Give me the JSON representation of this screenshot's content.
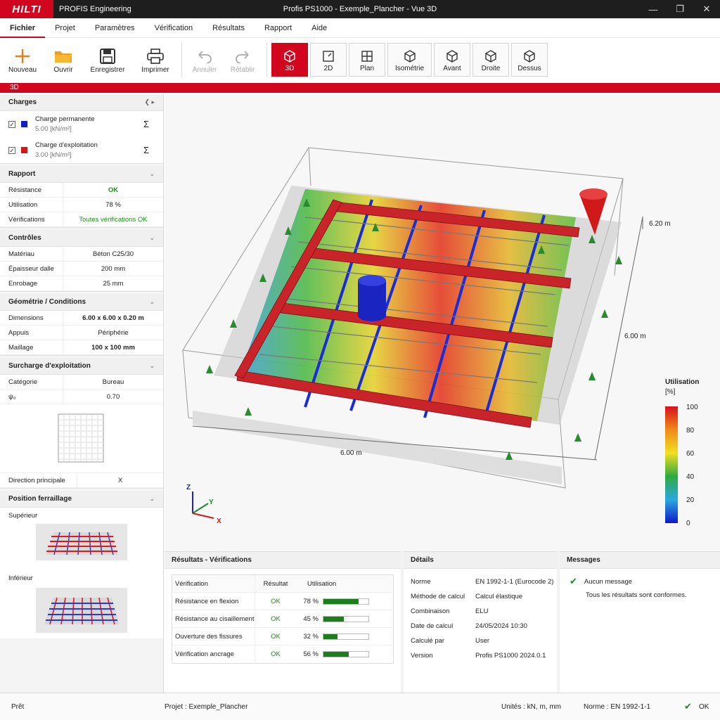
{
  "titlebar": {
    "logo": "HILTI",
    "app_name": "PROFIS Engineering",
    "window_title": "Profis PS1000 - Exemple_Plancher - Vue 3D",
    "controls": [
      "minimize-icon",
      "restore-icon",
      "close-icon"
    ]
  },
  "menu": [
    "Fichier",
    "Projet",
    "Paramètres",
    "Vérification",
    "Résultats",
    "Rapport",
    "Aide"
  ],
  "toolbar": {
    "file_buttons": [
      {
        "label": "Nouveau",
        "icon": "plus-icon"
      },
      {
        "label": "Ouvrir",
        "icon": "folder-icon"
      },
      {
        "label": "Enregistrer",
        "icon": "floppy-disk-icon"
      },
      {
        "label": "Imprimer",
        "icon": "printer-icon"
      }
    ],
    "undo_label": "Annuler",
    "redo_label": "Rétablir",
    "view_buttons": [
      "3D",
      "2D",
      "Plan",
      "Isométrie",
      "Avant",
      "Droite",
      "Dessus"
    ],
    "active_view": "3D"
  },
  "view_label": "3D",
  "colors": {
    "accent": "#d2051e",
    "ok": "#1c8a1c",
    "permanent": "#1020c0",
    "exploitation": "#d01818"
  },
  "left": {
    "charges": {
      "title": "Charges",
      "items": [
        {
          "name": "Charge permanente",
          "value": "5.00",
          "unit": "[kN/m²]"
        },
        {
          "name": "Charge d'exploitation",
          "value": "3.00",
          "unit": "[kN/m²]"
        }
      ]
    },
    "rapport": {
      "title": "Rapport",
      "rows": [
        {
          "k": "Résistance",
          "v": "OK"
        },
        {
          "k": "Utilisation",
          "v": "78 %"
        },
        {
          "k": "Vérifications",
          "v": "Toutes vérifications OK"
        }
      ]
    },
    "controles": {
      "title": "Contrôles",
      "rows": [
        {
          "k": "Matériau",
          "v": "Béton C25/30"
        },
        {
          "k": "Épaisseur dalle",
          "v": "200 mm"
        },
        {
          "k": "Enrobage",
          "v": "25 mm"
        }
      ]
    },
    "geometrie": {
      "title": "Géométrie / Conditions",
      "rows": [
        {
          "k": "Dimensions",
          "v": "6.00 x 6.00 x 0.20 m"
        },
        {
          "k": "Appuis",
          "v": "Périphérie"
        },
        {
          "k": "Maillage",
          "v": "100 x 100 mm"
        }
      ]
    },
    "surcharge": {
      "title": "Surcharge d'exploitation",
      "rows": [
        {
          "k": "Catégorie",
          "v": "Bureau"
        },
        {
          "k": "ψ₀",
          "v": "0.70"
        }
      ],
      "direction_k": "Direction principale",
      "direction_v": "X"
    },
    "ferraillage": {
      "title": "Position ferraillage",
      "superieur": "Supérieur",
      "inferieur": "Inférieur"
    }
  },
  "viewport": {
    "dim_x": "6.00 m",
    "dim_y": "6.00 m",
    "dim_z": "6.20 m",
    "legend_title": "Utilisation",
    "legend_unit": "[%]",
    "legend_ticks": [
      "100",
      "80",
      "60",
      "40",
      "20",
      "0"
    ],
    "axes": {
      "x": "X",
      "y": "Y",
      "z": "Z"
    }
  },
  "results": {
    "title": "Résultats - Vérifications",
    "headers": [
      "Vérification",
      "Résultat",
      "Utilisation"
    ],
    "rows": [
      {
        "name": "Résistance en flexion",
        "status": "OK",
        "util": "78 %",
        "fraction": 0.78
      },
      {
        "name": "Résistance au cisaillement",
        "status": "OK",
        "util": "45 %",
        "fraction": 0.45
      },
      {
        "name": "Ouverture des fissures",
        "status": "OK",
        "util": "32 %",
        "fraction": 0.32
      },
      {
        "name": "Vérification ancrage",
        "status": "OK",
        "util": "56 %",
        "fraction": 0.56
      }
    ]
  },
  "details": {
    "title": "Détails",
    "rows": [
      {
        "k": "Norme",
        "v": "EN 1992-1-1 (Eurocode 2)"
      },
      {
        "k": "Méthode de calcul",
        "v": "Calcul élastique"
      },
      {
        "k": "Combinaison",
        "v": "ELU"
      },
      {
        "k": "Date de calcul",
        "v": "24/05/2024 10:30"
      },
      {
        "k": "Calculé par",
        "v": "User"
      },
      {
        "k": "Version",
        "v": "Profis PS1000 2024.0.1"
      }
    ]
  },
  "messages": {
    "title": "Messages",
    "line1": "Aucun message",
    "line2": "Tous les résultats sont conformes."
  },
  "status": {
    "ready": "Prêt",
    "project": "Projet : Exemple_Plancher",
    "units": "Unités : kN, m, mm",
    "norm": "Norme : EN 1992-1-1",
    "ok": "OK"
  }
}
